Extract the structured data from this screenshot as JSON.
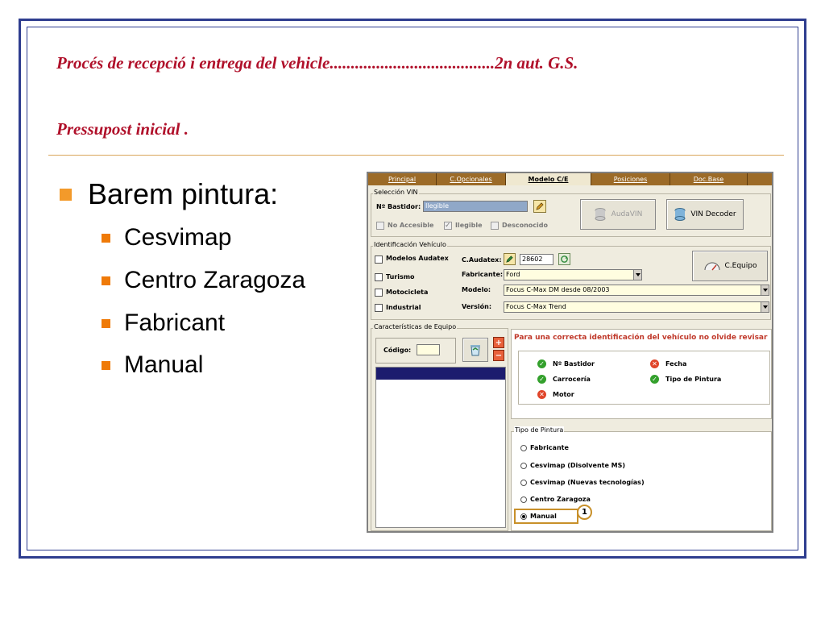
{
  "slide": {
    "title_line1": "Procés de recepció i entrega del vehicle.......................................2n aut. G.S.",
    "title_line2": "Pressupost inicial .",
    "main_bullet": "Barem pintura:",
    "sub_bullets": [
      "Cesvimap",
      "Centro Zaragoza",
      "Fabricant",
      "Manual"
    ]
  },
  "colors": {
    "title_red": "#b0102a",
    "bullet_orange": "#f39a2a",
    "frame_blue": "#2e3d8f",
    "tab_bar_brown": "#9c6b28"
  },
  "app": {
    "tabs": [
      {
        "label": "Principal",
        "active": false
      },
      {
        "label": "C.Opcionales",
        "active": false
      },
      {
        "label": "Modelo C/E",
        "active": true
      },
      {
        "label": "Posiciones",
        "active": false
      },
      {
        "label": "Doc.Base",
        "active": false
      }
    ],
    "vin": {
      "group_label": "Selección VIN",
      "bastidor_label": "Nº Bastidor:",
      "bastidor_value": "Ilegible",
      "opt_no_accesible": "No Accesible",
      "opt_ilegible": "Ilegible",
      "opt_desconocido": "Desconocido",
      "btn_audavin": "AudaVIN",
      "btn_vin_decoder": "VIN Decoder"
    },
    "ident": {
      "group_label": "Identificación Vehículo",
      "chk_modelos_audatex": "Modelos Audatex",
      "chk_turismo": "Turismo",
      "chk_motocicleta": "Motocicleta",
      "chk_industrial": "Industrial",
      "caudatex_label": "C.Audatex:",
      "caudatex_value": "28602",
      "fabricante_label": "Fabricante:",
      "fabricante_value": "Ford",
      "modelo_label": "Modelo:",
      "modelo_value": "Focus C-Max DM desde 08/2003",
      "version_label": "Versión:",
      "version_value": "Focus C-Max Trend",
      "btn_cequipo": "C.Equipo"
    },
    "equipo": {
      "group_label": "Características de Equipo",
      "codigo_label": "Código:",
      "codigo_value": ""
    },
    "revisar": {
      "header": "Para una correcta identificación del vehículo no olvide revisar",
      "items": [
        {
          "label": "Nº Bastidor",
          "status": "ok",
          "icon": "check-circle-icon"
        },
        {
          "label": "Fecha",
          "status": "error",
          "icon": "x-circle-icon"
        },
        {
          "label": "Carrocería",
          "status": "ok",
          "icon": "check-circle-icon"
        },
        {
          "label": "Tipo de Pintura",
          "status": "ok",
          "icon": "check-circle-icon"
        },
        {
          "label": "Motor",
          "status": "error",
          "icon": "x-circle-icon"
        }
      ]
    },
    "pintura": {
      "group_label": "Tipo de Pintura",
      "options": [
        "Fabricante",
        "Cesvimap (Disolvente MS)",
        "Cesvimap (Nuevas tecnologías)",
        "Centro Zaragoza",
        "Manual"
      ],
      "selected": "Manual",
      "callout_number": "1"
    }
  }
}
